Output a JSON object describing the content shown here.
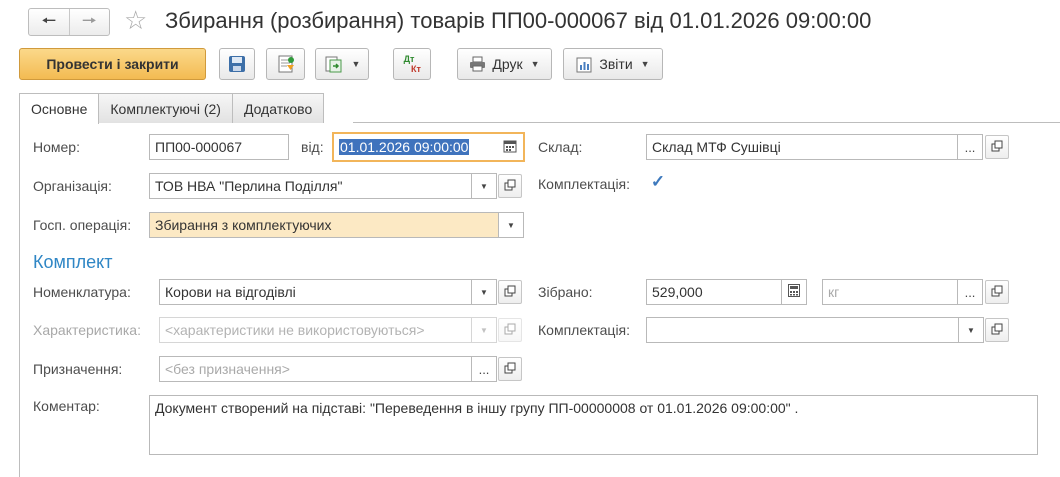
{
  "window": {
    "title": "Збирання (розбирання) товарів ПП00-000067 від 01.01.2026 09:00:00",
    "back_icon": "arrow-left-icon",
    "forward_icon": "arrow-right-icon",
    "favorite_icon": "star-icon"
  },
  "toolbar": {
    "post_and_close": "Провести і закрити",
    "print": "Друк",
    "reports": "Звіти",
    "dtkt_top": "Дт",
    "dtkt_bottom": "Кт"
  },
  "tabs": [
    {
      "label": "Основне",
      "active": true
    },
    {
      "label": "Комплектуючі (2)",
      "active": false
    },
    {
      "label": "Додатково",
      "active": false
    }
  ],
  "form": {
    "number_label": "Номер:",
    "number_value": "ПП00-000067",
    "date_label": "від:",
    "date_value": "01.01.2026 09:00:00",
    "warehouse_label": "Склад:",
    "warehouse_value": "Склад МТФ Сушівці",
    "organization_label": "Організація:",
    "organization_value": "ТОВ НВА \"Перлина Поділля\"",
    "completion_label": "Комплектація:",
    "completion_checked": true,
    "operation_label": "Госп. операція:",
    "operation_value": "Збирання з комплектуючих"
  },
  "kit": {
    "section_title": "Комплект",
    "nomenclature_label": "Номенклатура:",
    "nomenclature_value": "Корови на відгодівлі",
    "assembled_label": "Зібрано:",
    "assembled_value": "529,000",
    "unit_placeholder": "кг",
    "characteristic_label": "Характеристика:",
    "characteristic_placeholder": "<характеристики не використовуються>",
    "kit_completion_label": "Комплектація:",
    "kit_completion_value": "",
    "purpose_label": "Призначення:",
    "purpose_placeholder": "<без призначення>",
    "comment_label": "Коментар:",
    "comment_value": "Документ створений на підставі: \"Переведення в іншу групу  ПП-00000008 от 01.01.2026 09:00:00\" ."
  },
  "buttons": {
    "ellipsis": "...",
    "dropdown": "▼"
  },
  "colors": {
    "primary_button": "#f3bb52",
    "section_title": "#2f86c5",
    "yellow_field": "#fce9c4",
    "date_focus_border": "#f2b55a",
    "selection": "#3f73bd"
  }
}
